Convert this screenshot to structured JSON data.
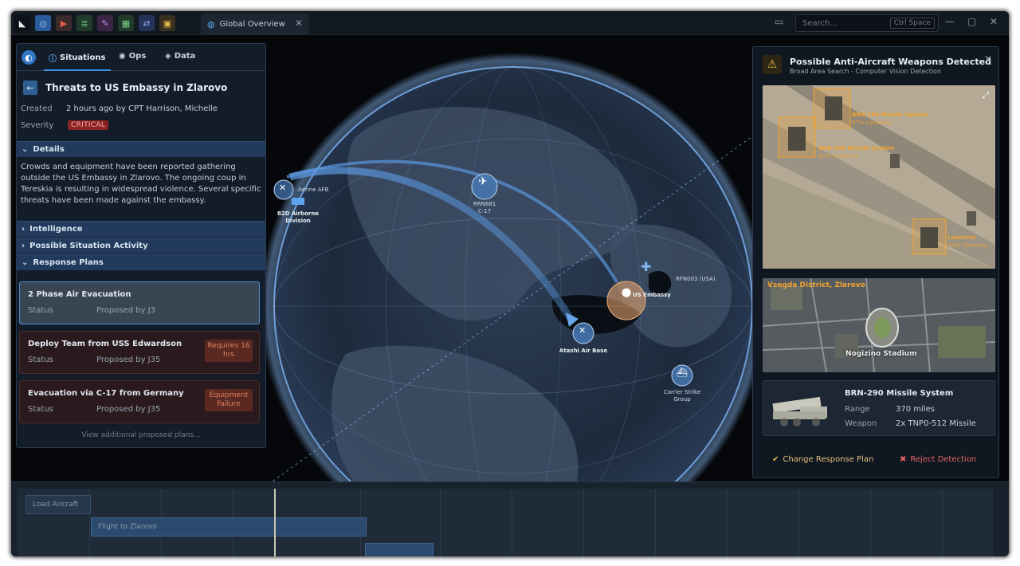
{
  "topbar": {
    "tab_label": "Global Overview",
    "search_placeholder": "Search...",
    "search_shortcut": "Ctrl Space"
  },
  "map_labels": {
    "airbase_west": "Aerine AFB",
    "division": "82D Airborne\nDivision",
    "aircraft": "RRN881\nC-17",
    "embassy": "US Embassy",
    "satellite": "RFN003 (USA)",
    "air_base": "Atashi Air Base",
    "carrier_group": "Carrier Strike\nGroup"
  },
  "left_panel": {
    "tabs": [
      "Situations",
      "Ops",
      "Data"
    ],
    "title": "Threats to US Embassy in Zlarovo",
    "created_label": "Created",
    "created_value": "2 hours ago by CPT Harrison, Michelle",
    "severity_label": "Severity",
    "severity_value": "CRITICAL",
    "details_label": "Details",
    "description": "Crowds and equipment have been reported gathering outside the US Embassy in Zlarovo. The ongoing coup in Tereskia is resulting in widespread violence. Several specific threats have been made against the embassy.",
    "sections": [
      "Intelligence",
      "Possible Situation Activity",
      "Response Plans"
    ],
    "plans": [
      {
        "title": "2 Phase Air Evacuation",
        "status": "Status",
        "by": "Proposed by J3",
        "badge": ""
      },
      {
        "title": "Deploy Team from USS Edwardson",
        "status": "Status",
        "by": "Proposed by J35",
        "badge": "Requires 16 hrs"
      },
      {
        "title": "Evacuation via C-17 from Germany",
        "status": "Status",
        "by": "Proposed by J35",
        "badge": "Equipment Failure"
      }
    ],
    "more_link": "View additional proposed plans..."
  },
  "right_panel": {
    "title": "Possible Anti-Aircraft Weapons Detected",
    "subtitle": "Broad Area Search - Computer Vision Detection",
    "detections": [
      {
        "name": "BRN-290 Missile System",
        "certainty": "87% Certainty"
      },
      {
        "name": "BRN-290 Missile System",
        "certainty": "67% Certainty"
      },
      {
        "name": "Launcher",
        "certainty": "70% Certainty"
      }
    ],
    "district": "Vsegda District, Zlarovo",
    "stadium": "Nogizino Stadium",
    "system_name": "BRN-290 Missile System",
    "range_label": "Range",
    "range_value": "370 miles",
    "weapon_label": "Weapon",
    "weapon_value": "2x TNP0-512 Missile",
    "change_label": "Change Response Plan",
    "reject_label": "Reject Detection"
  },
  "timeline": {
    "load_label": "Load Aircraft",
    "flight_label": "Flight to Zlarovo"
  },
  "colors": {
    "accent": "#3b8fe0",
    "critical": "#8a2323",
    "detection": "#f2a331",
    "reject": "#e16464"
  }
}
